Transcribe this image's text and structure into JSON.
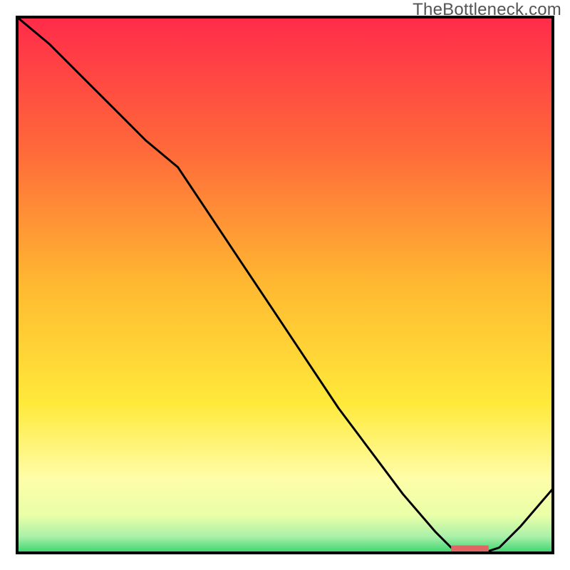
{
  "watermark": "TheBottleneck.com",
  "chart_data": {
    "type": "line",
    "title": "",
    "xlabel": "",
    "ylabel": "",
    "xlim": [
      0,
      100
    ],
    "ylim": [
      0,
      100
    ],
    "grid": false,
    "x": [
      0,
      6,
      12,
      18,
      24,
      30,
      36,
      42,
      48,
      54,
      60,
      66,
      72,
      78,
      81,
      84,
      87,
      90,
      94,
      100
    ],
    "values": [
      100,
      95,
      89,
      83,
      77,
      72,
      63,
      54,
      45,
      36,
      27,
      19,
      11,
      4,
      1,
      0,
      0,
      1,
      5,
      12
    ],
    "optimal_range": {
      "x_start": 81,
      "x_end": 88,
      "thickness_pct": 1.4
    },
    "gradient_stops": [
      {
        "pct": 0,
        "color": "#ff2b4a"
      },
      {
        "pct": 25,
        "color": "#ff6a3a"
      },
      {
        "pct": 50,
        "color": "#ffb931"
      },
      {
        "pct": 72,
        "color": "#ffe93a"
      },
      {
        "pct": 86,
        "color": "#fffda8"
      },
      {
        "pct": 93,
        "color": "#e9ffa8"
      },
      {
        "pct": 97,
        "color": "#a8f0a8"
      },
      {
        "pct": 100,
        "color": "#39d46e"
      }
    ]
  }
}
